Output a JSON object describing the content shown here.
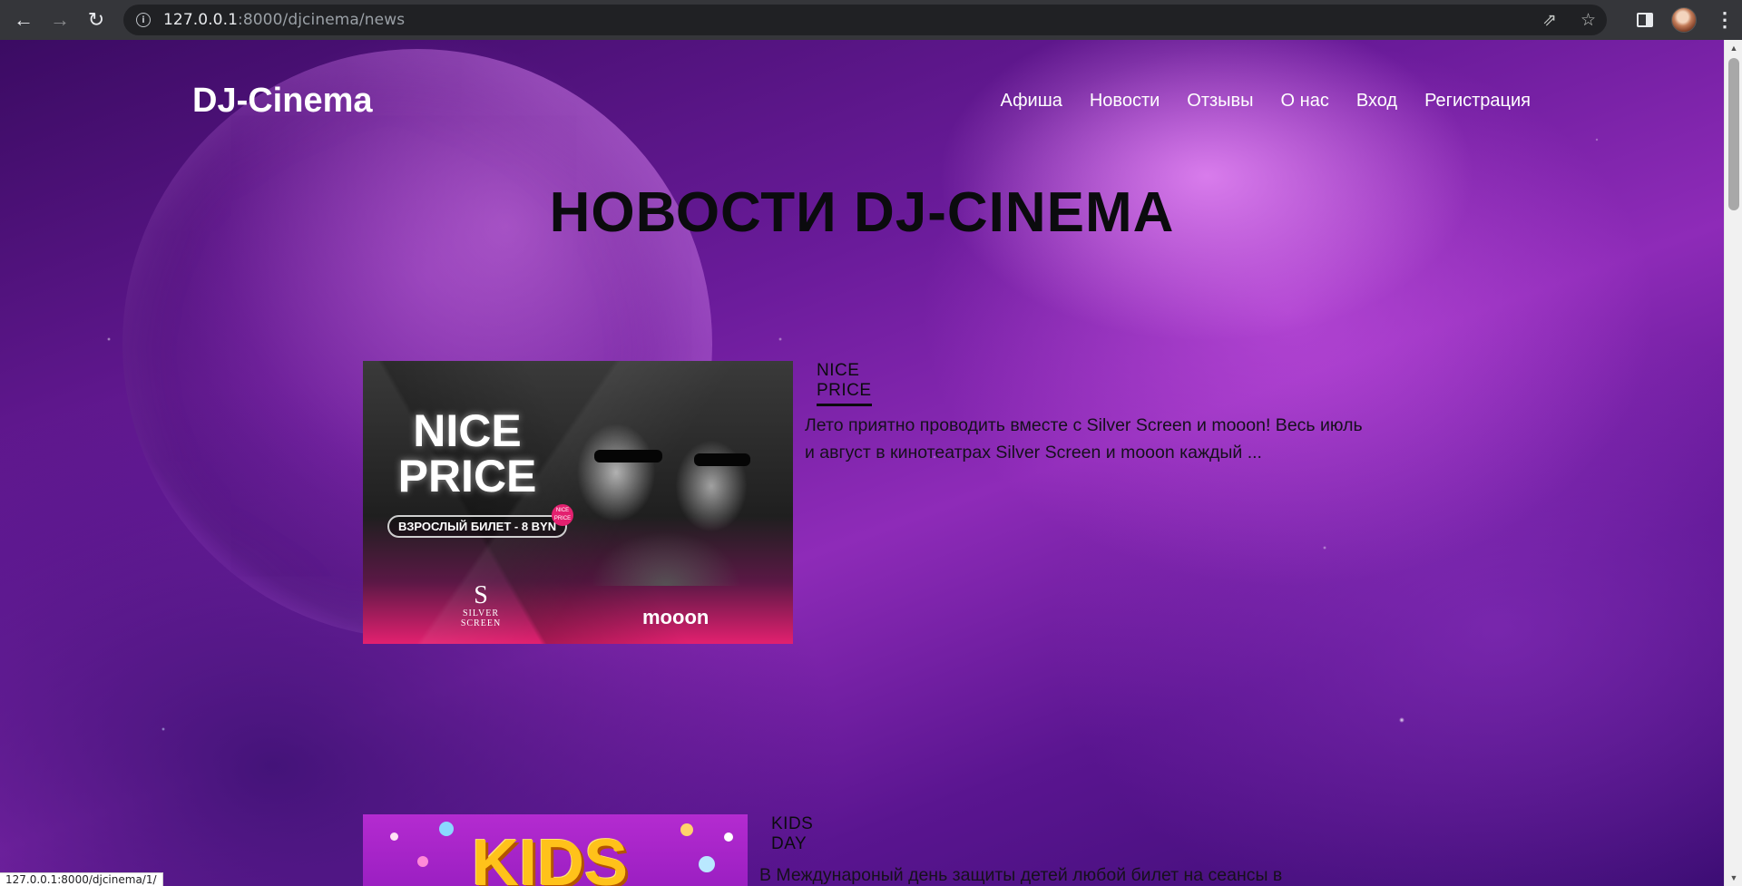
{
  "browser": {
    "url_host": "127.0.0.1",
    "url_rest": ":8000/djcinema/news",
    "status_url": "127.0.0.1:8000/djcinema/1/"
  },
  "site": {
    "logo": "DJ-Cinema",
    "nav": [
      "Афиша",
      "Новости",
      "Отзывы",
      "О нас",
      "Вход",
      "Регистрация"
    ],
    "page_title": "НОВОСТИ DJ-CINEMA"
  },
  "news": [
    {
      "title": "NICE PRICE",
      "excerpt": "Лето приятно проводить вместе с Silver Screen и mooon! Весь июль и август в кинотеатрах Silver Screen и mooon каждый ...",
      "poster": {
        "line1": "NICE",
        "line2": "PRICE",
        "badge": "ВЗРОСЛЫЙ БИЛЕТ - 8 BYN",
        "dot": "NICE PRICE",
        "ss_letter": "S",
        "ss_name": "SILVER SCREEN",
        "mooon": "mooon"
      }
    },
    {
      "title": "KIDS DAY",
      "excerpt": "В Междунароный день защиты детей любой билет на сеансы в",
      "poster": {
        "word": "KIDS"
      }
    }
  ],
  "colors": {
    "chrome_bg": "#35363a",
    "omnibox_bg": "#202124",
    "title_text": "#0b0b0e",
    "nav_text": "#ffffff",
    "accent_pink": "#e3206f"
  }
}
